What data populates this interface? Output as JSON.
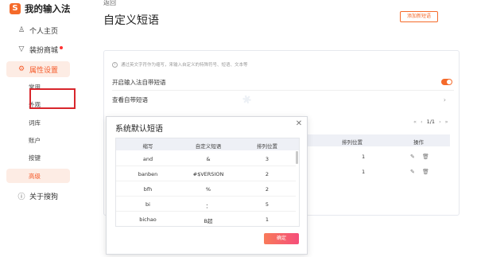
{
  "sidebar": {
    "brand": "我的输入法",
    "brand_logo": "S",
    "items": [
      {
        "label": "个人主页",
        "icon": "person-icon"
      },
      {
        "label": "装扮商城",
        "icon": "shirt-icon"
      },
      {
        "label": "属性设置",
        "icon": "gear-icon"
      }
    ],
    "sub_items": [
      "常用",
      "外观",
      "词库",
      "账户",
      "按键",
      "高级"
    ],
    "about": {
      "label": "关于搜狗",
      "icon": "info-icon"
    }
  },
  "header": {
    "back": "返回",
    "title": "自定义短语",
    "add_button": "添加新短语"
  },
  "card": {
    "hint": "通过英文字符作为缩写，来输入自定义的特殊符号、短语、文本等",
    "toggle_label": "开启输入法自带短语",
    "view_label": "查看自带短语"
  },
  "background_table": {
    "pager": {
      "prev2": "«",
      "prev": "‹",
      "current": "1/1",
      "next": "›",
      "next2": "»"
    },
    "columns": [
      "排列位置",
      "操作"
    ],
    "rows": [
      {
        "position": "1"
      },
      {
        "position": "1"
      }
    ]
  },
  "dialog": {
    "title": "系统默认短语",
    "columns": [
      "缩写",
      "自定义短语",
      "排列位置"
    ],
    "rows": [
      {
        "abbr": "and",
        "phrase": "&",
        "pos": "3"
      },
      {
        "abbr": "banben",
        "phrase": "#$VERSION",
        "pos": "2"
      },
      {
        "abbr": "bfh",
        "phrase": "%",
        "pos": "2"
      },
      {
        "abbr": "bi",
        "phrase": "：",
        "pos": "5"
      },
      {
        "abbr": "bichao",
        "phrase": "B超",
        "pos": "1"
      }
    ],
    "ok_button": "确定"
  },
  "colors": {
    "accent": "#f56a2a",
    "highlight_box": "#d8262c"
  }
}
